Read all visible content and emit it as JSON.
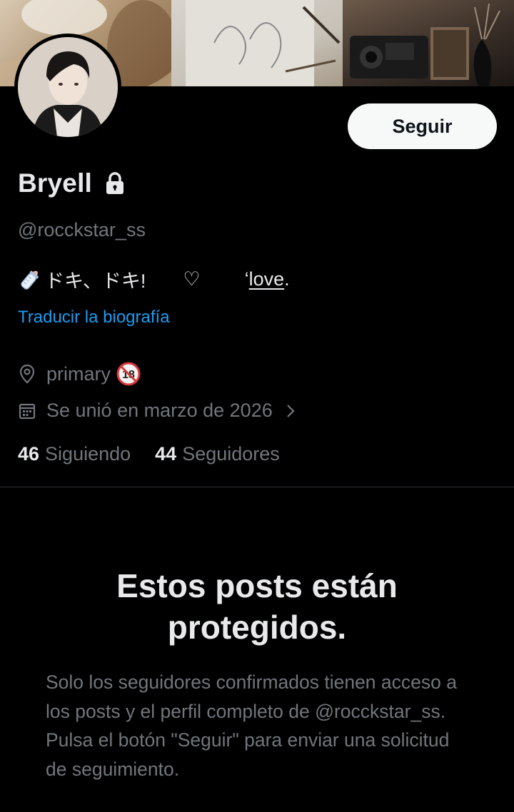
{
  "profile": {
    "display_name": "Bryell",
    "handle": "@rocckstar_ss",
    "follow_label": "Seguir",
    "bio": {
      "emoji_icon": "baby-bottle-icon",
      "text1": "ドキ、ドキ!",
      "heart": "♡",
      "love_prefix": "‘",
      "love_underlined": "love",
      "love_suffix": "."
    },
    "translate_label": "Traducir la biografía",
    "location": "primary",
    "location_badge_icon": "no-under-18-icon",
    "joined": "Se unió en marzo de 2026",
    "following_count": "46",
    "following_label": "Siguiendo",
    "followers_count": "44",
    "followers_label": "Seguidores"
  },
  "protected": {
    "title": "Estos posts están protegidos.",
    "description": "Solo los seguidores confirmados tienen acceso a los posts y el perfil completo de @rocckstar_ss. Pulsa el botón \"Seguir\" para enviar una solicitud de seguimiento."
  },
  "colors": {
    "background": "#000000",
    "text_primary": "#e7e9ea",
    "text_secondary": "#71767b",
    "link": "#1d9bf0",
    "button_bg": "#f7f9f9"
  }
}
